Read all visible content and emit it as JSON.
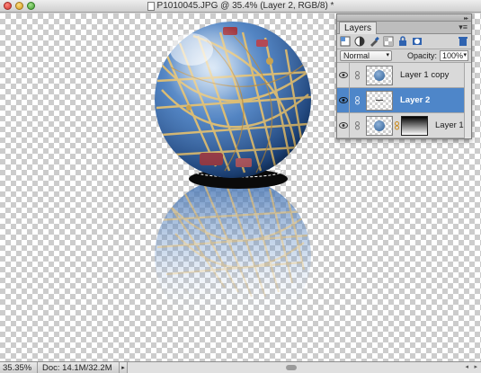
{
  "window": {
    "title": "P1010045.JPG @ 35.4% (Layer 2, RGB/8) *"
  },
  "layers_panel": {
    "tab_label": "Layers",
    "blend_mode": "Normal",
    "opacity_label": "Opacity:",
    "opacity_value": "100%",
    "layers": [
      {
        "name": "Layer 1 copy",
        "visible": true,
        "selected": false,
        "has_mask": false
      },
      {
        "name": "Layer 2",
        "visible": true,
        "selected": true,
        "has_mask": false
      },
      {
        "name": "Layer 1",
        "visible": true,
        "selected": false,
        "has_mask": true
      }
    ]
  },
  "status_bar": {
    "zoom": "35.35%",
    "doc_info": "Doc: 14.1M/32.2M"
  },
  "colors": {
    "selection_highlight": "#4e86c9",
    "sky_blue": "#3f6fb0",
    "canvas_checker": "#cccccc"
  },
  "icons": {
    "close": "close-icon",
    "minimize": "minimize-icon",
    "zoom": "zoom-icon",
    "document": "document-icon",
    "new_layer": "new-layer-icon",
    "adjustment": "adjustment-layer-icon",
    "brush": "brush-icon",
    "lock_transparency": "lock-transparency-icon",
    "lock": "lock-icon",
    "layer_mask": "layer-mask-icon",
    "delete": "trash-icon",
    "eye": "eye-icon",
    "link": "link-icon"
  }
}
